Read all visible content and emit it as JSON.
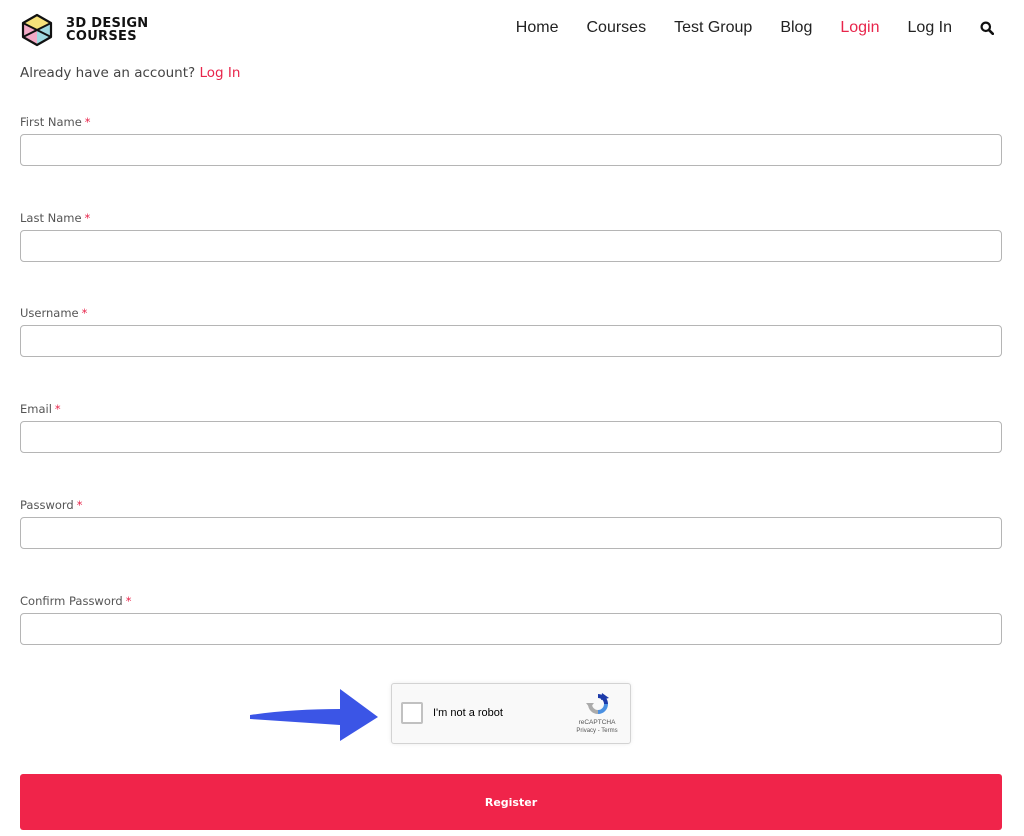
{
  "brand": {
    "name_line1": "3D DESIGN",
    "name_line2": "COURSES",
    "logo_icon": "isometric-cube-logo"
  },
  "nav": {
    "items": [
      {
        "label": "Home"
      },
      {
        "label": "Courses"
      },
      {
        "label": "Test Group"
      },
      {
        "label": "Blog"
      },
      {
        "label": "Login",
        "active": true
      },
      {
        "label": "Log In"
      }
    ],
    "search_icon": "search-icon"
  },
  "account_prompt": {
    "text": "Already have an account?",
    "link": "Log In"
  },
  "form": {
    "required_marker": "*",
    "fields": [
      {
        "label": "First Name",
        "value": "",
        "type": "text"
      },
      {
        "label": "Last Name",
        "value": "",
        "type": "text"
      },
      {
        "label": "Username",
        "value": "",
        "type": "text"
      },
      {
        "label": "Email",
        "value": "",
        "type": "email"
      },
      {
        "label": "Password",
        "value": "",
        "type": "password"
      },
      {
        "label": "Confirm Password",
        "value": "",
        "type": "password"
      }
    ],
    "submit_label": "Register"
  },
  "recaptcha": {
    "checkbox_label": "I'm not a robot",
    "brand": "reCAPTCHA",
    "links": "Privacy - Terms",
    "checked": false
  },
  "colors": {
    "accent": "#e8254b",
    "button": "#f0244a",
    "arrow": "#3b55e6"
  }
}
